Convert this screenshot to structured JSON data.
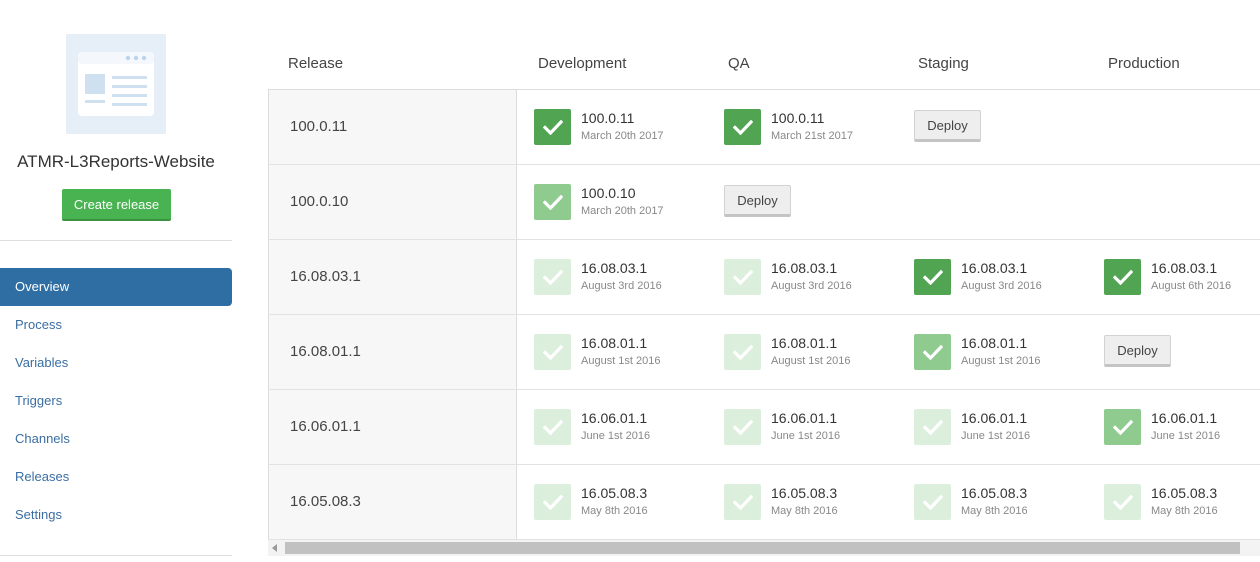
{
  "project": {
    "name": "ATMR-L3Reports-Website",
    "create_release_label": "Create release"
  },
  "nav": {
    "items": [
      {
        "label": "Overview",
        "active": true
      },
      {
        "label": "Process"
      },
      {
        "label": "Variables"
      },
      {
        "label": "Triggers"
      },
      {
        "label": "Channels"
      },
      {
        "label": "Releases"
      },
      {
        "label": "Settings"
      }
    ]
  },
  "table": {
    "headers": {
      "release": "Release",
      "development": "Development",
      "qa": "QA",
      "staging": "Staging",
      "production": "Production"
    },
    "rows": [
      {
        "release": "100.0.11",
        "development": {
          "version": "100.0.11",
          "date": "March 20th 2017",
          "state": "current"
        },
        "qa": {
          "version": "100.0.11",
          "date": "March 21st 2017",
          "state": "current"
        },
        "staging": {
          "deploy_label": "Deploy"
        },
        "production": null
      },
      {
        "release": "100.0.10",
        "development": {
          "version": "100.0.10",
          "date": "March 20th 2017",
          "state": "mid"
        },
        "qa": {
          "deploy_label": "Deploy"
        },
        "staging": null,
        "production": null
      },
      {
        "release": "16.08.03.1",
        "development": {
          "version": "16.08.03.1",
          "date": "August 3rd 2016",
          "state": "old"
        },
        "qa": {
          "version": "16.08.03.1",
          "date": "August 3rd 2016",
          "state": "old"
        },
        "staging": {
          "version": "16.08.03.1",
          "date": "August 3rd 2016",
          "state": "current"
        },
        "production": {
          "version": "16.08.03.1",
          "date": "August 6th 2016",
          "state": "current"
        }
      },
      {
        "release": "16.08.01.1",
        "development": {
          "version": "16.08.01.1",
          "date": "August 1st 2016",
          "state": "old"
        },
        "qa": {
          "version": "16.08.01.1",
          "date": "August 1st 2016",
          "state": "old"
        },
        "staging": {
          "version": "16.08.01.1",
          "date": "August 1st 2016",
          "state": "mid"
        },
        "production": {
          "deploy_label": "Deploy"
        }
      },
      {
        "release": "16.06.01.1",
        "development": {
          "version": "16.06.01.1",
          "date": "June 1st 2016",
          "state": "old"
        },
        "qa": {
          "version": "16.06.01.1",
          "date": "June 1st 2016",
          "state": "old"
        },
        "staging": {
          "version": "16.06.01.1",
          "date": "June 1st 2016",
          "state": "old"
        },
        "production": {
          "version": "16.06.01.1",
          "date": "June 1st 2016",
          "state": "mid"
        }
      },
      {
        "release": "16.05.08.3",
        "development": {
          "version": "16.05.08.3",
          "date": "May 8th 2016",
          "state": "old"
        },
        "qa": {
          "version": "16.05.08.3",
          "date": "May 8th 2016",
          "state": "old"
        },
        "staging": {
          "version": "16.05.08.3",
          "date": "May 8th 2016",
          "state": "old"
        },
        "production": {
          "version": "16.05.08.3",
          "date": "May 8th 2016",
          "state": "old"
        }
      }
    ]
  },
  "colors": {
    "accent": "#2f6ea3",
    "create_button": "#48b350",
    "success": "#50a452",
    "success_mid": "#8fca8f",
    "success_faded": "#dcefdc"
  },
  "icons": {
    "project_logo": "browser-window-icon",
    "deployed": "checkmark-icon",
    "scroll_left": "chevron-left-icon"
  }
}
